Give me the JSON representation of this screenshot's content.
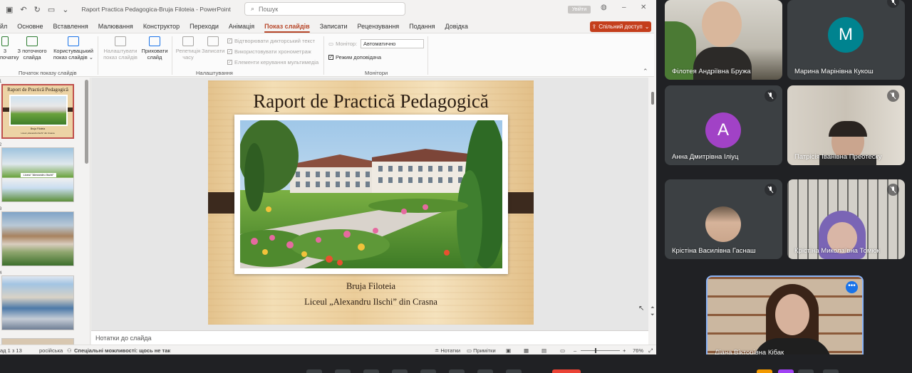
{
  "ppt": {
    "doc_title": "Raport Practica Pedagogica-Bruja Filoteia  -  PowerPoint",
    "search_placeholder": "Пошук",
    "signin_label": "Увійти",
    "tabs": [
      "йл",
      "Основне",
      "Вставлення",
      "Малювання",
      "Конструктор",
      "Переходи",
      "Анімація",
      "Показ слайдів",
      "Записати",
      "Рецензування",
      "Подання",
      "Довідка"
    ],
    "active_tab": "Показ слайдів",
    "share_label": "Спільний доступ",
    "ribbon": {
      "from_beginning": "З\nпочатку",
      "from_current": "З поточного\nслайда",
      "custom_show": "Користувацький\nпоказ слайдів",
      "group_start": "Початок показу слайдів",
      "setup_show": "Налаштувати\nпоказ слайдів",
      "hide_slide": "Приховати\nслайд",
      "rehearse": "Репетиція\nчасу",
      "record": "Записати",
      "play_narrations": "Відтворювати дикторський текст",
      "use_timings": "Використовувати хронометраж",
      "show_media_controls": "Елементи керування мультимедіа",
      "group_setup": "Налаштування",
      "monitor_label": "Монітор:",
      "monitor_value": "Автоматично",
      "presenter_view": "Режим доповідача",
      "group_monitors": "Монітори"
    },
    "slide": {
      "title": "Raport de Practică Pedagogică",
      "author": "Bruja Filoteia",
      "school": "Liceul „Alexandru Ilschi” din Crasna"
    },
    "thumb2_caption": "Liceul \"Alexandru Ilschi\"",
    "notes_placeholder": "Нотатки до слайда",
    "status": {
      "slide_counter": "ад 1 з 13",
      "language": "російська",
      "accessibility": "Спеціальні можливості: щось не так",
      "notes_btn": "Нотатки",
      "comments_btn": "Примітки",
      "zoom": "76%"
    }
  },
  "meeting": {
    "participants": [
      {
        "name": "Філотея Андріївна Бружа",
        "muted": false
      },
      {
        "name": "Марина Марінівна Кукош",
        "initial": "M",
        "color": "#00838f",
        "muted": true
      },
      {
        "name": "Анна Дмитрівна Іліуц",
        "initial": "A",
        "color": "#a142c6",
        "muted": true
      },
      {
        "name": "Патрісія Іванівна Преотеску",
        "muted": true
      },
      {
        "name": "Крістіна Василівна Гаснаш",
        "muted": true
      },
      {
        "name": "Крістіна Миколаївна Томюк",
        "muted": true
      },
      {
        "name": "Діана Вікторівна Кібак",
        "muted": false
      }
    ]
  },
  "colors": {
    "accent": "#c43e1c",
    "active_tab": "#b7472a",
    "meeting_bg": "#202124",
    "tile_bg": "#3c4043",
    "active_speaker": "#8ab4f8"
  }
}
